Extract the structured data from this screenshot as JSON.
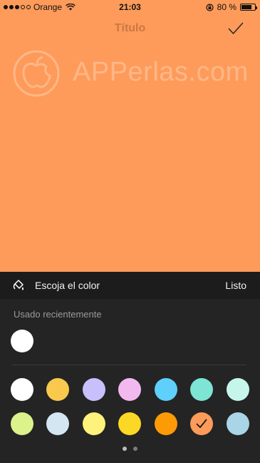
{
  "status_bar": {
    "carrier": "Orange",
    "time": "21:03",
    "battery": "80 %",
    "battery_level": 0.8
  },
  "nav": {
    "title": "Título"
  },
  "watermark": {
    "text": "APPerlas.com"
  },
  "sheet": {
    "title": "Escoja el color",
    "done_label": "Listo",
    "recent_label": "Usado recientemente"
  },
  "colors": {
    "canvas": "#fe9b5a",
    "sheet_bg": "#242424",
    "header_bg": "#1c1c1c",
    "recent": "#ffffff",
    "palette_row1": [
      "#ffffff",
      "#f9c94e",
      "#c8c0fb",
      "#f2b9ef",
      "#5fcffb",
      "#7ee4d4",
      "#c6f6eb"
    ],
    "palette_row2": [
      "#dcf28b",
      "#d3e6f2",
      "#fef17c",
      "#fcd826",
      "#fc9b06",
      "#fe9b5a",
      "#a9d5e6"
    ],
    "selected": "#fe9b5a"
  },
  "pager": {
    "pages": 2,
    "current": 1
  }
}
